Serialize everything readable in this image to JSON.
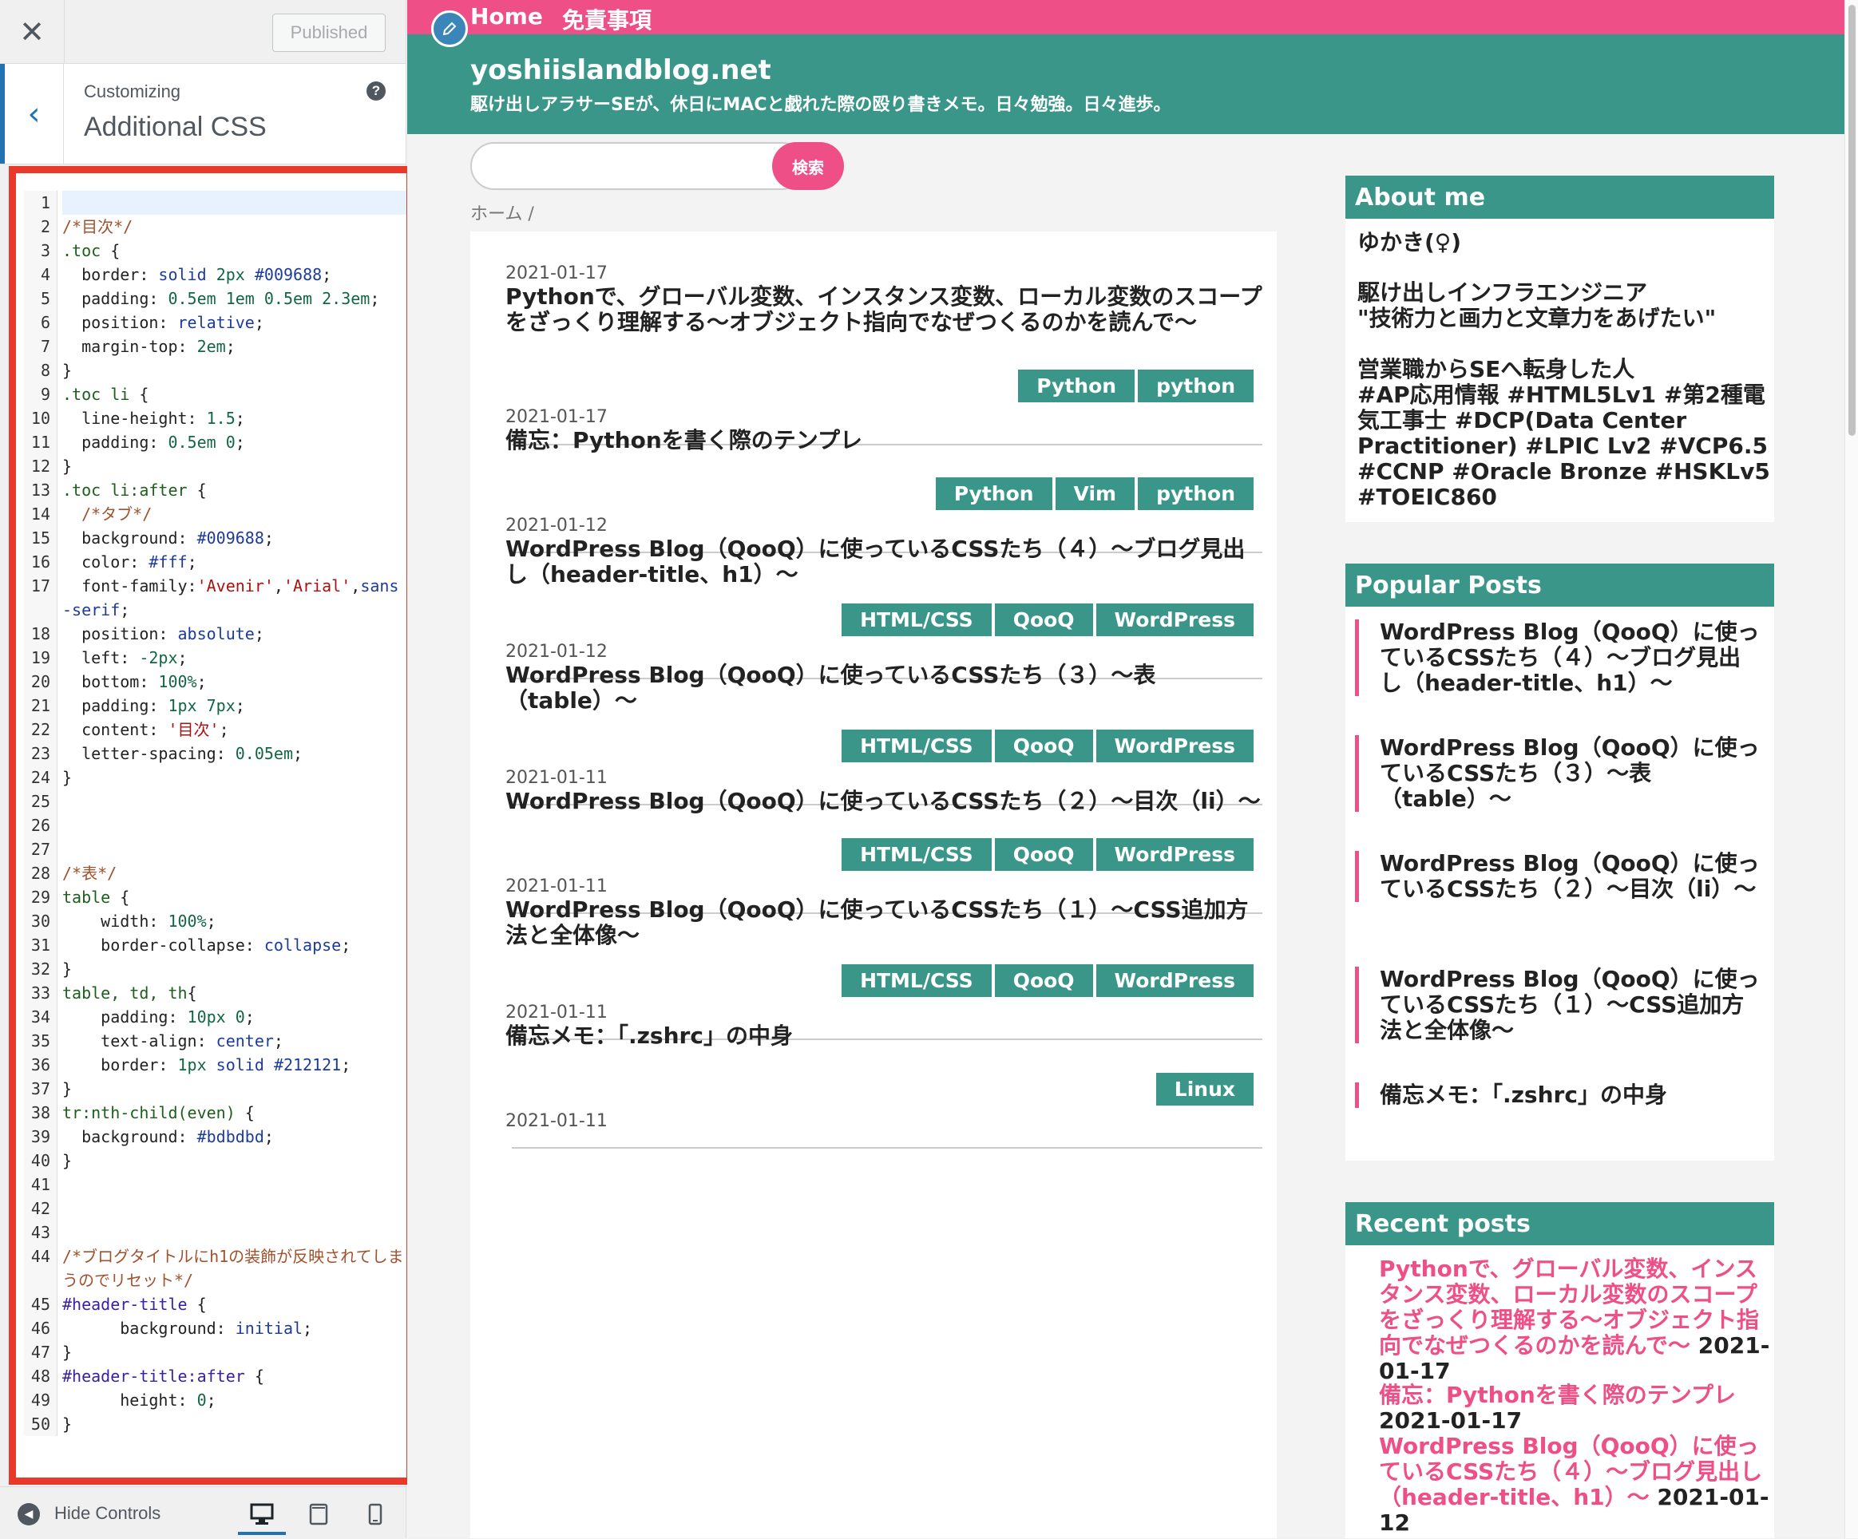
{
  "panel": {
    "close_icon": "✕",
    "published_label": "Published",
    "back_icon": "‹",
    "customizing_label": "Customizing",
    "section_title": "Additional CSS",
    "help_icon": "?",
    "hide_controls_label": "Hide Controls",
    "accent_color": "#2271b1",
    "highlight_color": "#e8392b"
  },
  "code_lines": [
    {
      "n": "1",
      "active": true,
      "parts": []
    },
    {
      "n": "2",
      "parts": [
        [
          "com",
          "/*目次*/"
        ]
      ]
    },
    {
      "n": "3",
      "parts": [
        [
          "sel",
          ".toc"
        ],
        [
          "",
          " {"
        ]
      ]
    },
    {
      "n": "4",
      "parts": [
        [
          "",
          "  border: "
        ],
        [
          "val",
          "solid"
        ],
        [
          "",
          " "
        ],
        [
          "num",
          "2px"
        ],
        [
          "",
          " "
        ],
        [
          "val",
          "#009688"
        ],
        [
          "",
          ";"
        ]
      ]
    },
    {
      "n": "5",
      "parts": [
        [
          "",
          "  padding: "
        ],
        [
          "num",
          "0.5em 1em 0.5em 2.3em"
        ],
        [
          "",
          ";"
        ]
      ]
    },
    {
      "n": "6",
      "parts": [
        [
          "",
          "  position: "
        ],
        [
          "val",
          "relative"
        ],
        [
          "",
          ";"
        ]
      ]
    },
    {
      "n": "7",
      "parts": [
        [
          "",
          "  margin-top: "
        ],
        [
          "num",
          "2em"
        ],
        [
          "",
          ";"
        ]
      ]
    },
    {
      "n": "8",
      "parts": [
        [
          "",
          "}"
        ]
      ]
    },
    {
      "n": "9",
      "parts": [
        [
          "sel",
          ".toc li"
        ],
        [
          "",
          " {"
        ]
      ]
    },
    {
      "n": "10",
      "parts": [
        [
          "",
          "  line-height: "
        ],
        [
          "num",
          "1.5"
        ],
        [
          "",
          ";"
        ]
      ]
    },
    {
      "n": "11",
      "parts": [
        [
          "",
          "  padding: "
        ],
        [
          "num",
          "0.5em 0"
        ],
        [
          "",
          ";"
        ]
      ]
    },
    {
      "n": "12",
      "parts": [
        [
          "",
          "}"
        ]
      ]
    },
    {
      "n": "13",
      "parts": [
        [
          "sel",
          ".toc li:after"
        ],
        [
          "",
          " {"
        ]
      ]
    },
    {
      "n": "14",
      "parts": [
        [
          "com",
          "  /*タブ*/"
        ]
      ]
    },
    {
      "n": "15",
      "parts": [
        [
          "",
          "  background: "
        ],
        [
          "val",
          "#009688"
        ],
        [
          "",
          ";"
        ]
      ]
    },
    {
      "n": "16",
      "parts": [
        [
          "",
          "  color: "
        ],
        [
          "val",
          "#fff"
        ],
        [
          "",
          ";"
        ]
      ]
    },
    {
      "n": "17",
      "parts": [
        [
          "",
          "  font-family:"
        ],
        [
          "str",
          "'Avenir'"
        ],
        [
          "",
          ","
        ],
        [
          "str",
          "'Arial'"
        ],
        [
          "",
          ","
        ],
        [
          "val",
          "sans-serif"
        ],
        [
          "",
          ";"
        ]
      ]
    },
    {
      "n": "18",
      "parts": [
        [
          "",
          "  position: "
        ],
        [
          "val",
          "absolute"
        ],
        [
          "",
          ";"
        ]
      ]
    },
    {
      "n": "19",
      "parts": [
        [
          "",
          "  left: "
        ],
        [
          "num",
          "-2px"
        ],
        [
          "",
          ";"
        ]
      ]
    },
    {
      "n": "20",
      "parts": [
        [
          "",
          "  bottom: "
        ],
        [
          "num",
          "100%"
        ],
        [
          "",
          ";"
        ]
      ]
    },
    {
      "n": "21",
      "parts": [
        [
          "",
          "  padding: "
        ],
        [
          "num",
          "1px 7px"
        ],
        [
          "",
          ";"
        ]
      ]
    },
    {
      "n": "22",
      "parts": [
        [
          "",
          "  content: "
        ],
        [
          "str",
          "'目次'"
        ],
        [
          "",
          ";"
        ]
      ]
    },
    {
      "n": "23",
      "parts": [
        [
          "",
          "  letter-spacing: "
        ],
        [
          "num",
          "0.05em"
        ],
        [
          "",
          ";"
        ]
      ]
    },
    {
      "n": "24",
      "parts": [
        [
          "",
          "}"
        ]
      ]
    },
    {
      "n": "25",
      "parts": []
    },
    {
      "n": "26",
      "parts": []
    },
    {
      "n": "27",
      "parts": []
    },
    {
      "n": "28",
      "parts": [
        [
          "com",
          "/*表*/"
        ]
      ]
    },
    {
      "n": "29",
      "parts": [
        [
          "sel",
          "table"
        ],
        [
          "",
          " {"
        ]
      ]
    },
    {
      "n": "30",
      "parts": [
        [
          "",
          "    width: "
        ],
        [
          "num",
          "100%"
        ],
        [
          "",
          ";"
        ]
      ]
    },
    {
      "n": "31",
      "parts": [
        [
          "",
          "    border-collapse: "
        ],
        [
          "val",
          "collapse"
        ],
        [
          "",
          ";"
        ]
      ]
    },
    {
      "n": "32",
      "parts": [
        [
          "",
          "}"
        ]
      ]
    },
    {
      "n": "33",
      "parts": [
        [
          "sel",
          "table, td, th"
        ],
        [
          "",
          "{"
        ]
      ]
    },
    {
      "n": "34",
      "parts": [
        [
          "",
          "    padding: "
        ],
        [
          "num",
          "10px 0"
        ],
        [
          "",
          ";"
        ]
      ]
    },
    {
      "n": "35",
      "parts": [
        [
          "",
          "    text-align: "
        ],
        [
          "val",
          "center"
        ],
        [
          "",
          ";"
        ]
      ]
    },
    {
      "n": "36",
      "parts": [
        [
          "",
          "    border: "
        ],
        [
          "num",
          "1px"
        ],
        [
          "",
          " "
        ],
        [
          "val",
          "solid"
        ],
        [
          "",
          " "
        ],
        [
          "val",
          "#212121"
        ],
        [
          "",
          ";"
        ]
      ]
    },
    {
      "n": "37",
      "parts": [
        [
          "",
          "}"
        ]
      ]
    },
    {
      "n": "38",
      "parts": [
        [
          "sel",
          "tr:nth-child(even)"
        ],
        [
          "",
          " {"
        ]
      ]
    },
    {
      "n": "39",
      "parts": [
        [
          "",
          "  background: "
        ],
        [
          "val",
          "#bdbdbd"
        ],
        [
          "",
          ";"
        ]
      ]
    },
    {
      "n": "40",
      "parts": [
        [
          "",
          "}"
        ]
      ]
    },
    {
      "n": "41",
      "parts": []
    },
    {
      "n": "42",
      "parts": []
    },
    {
      "n": "43",
      "parts": []
    },
    {
      "n": "44",
      "parts": [
        [
          "com",
          "/*ブログタイトルにh1の装飾が反映されてしまうのでリセット*/"
        ]
      ]
    },
    {
      "n": "45",
      "parts": [
        [
          "id",
          "#header-title"
        ],
        [
          "",
          " {"
        ]
      ]
    },
    {
      "n": "46",
      "parts": [
        [
          "",
          "      background: "
        ],
        [
          "val",
          "initial"
        ],
        [
          "",
          ";"
        ]
      ]
    },
    {
      "n": "47",
      "parts": [
        [
          "",
          "}"
        ]
      ]
    },
    {
      "n": "48",
      "parts": [
        [
          "id",
          "#header-title:after"
        ],
        [
          "",
          " {"
        ]
      ]
    },
    {
      "n": "49",
      "parts": [
        [
          "",
          "      height: "
        ],
        [
          "num",
          "0"
        ],
        [
          "",
          ";"
        ]
      ]
    },
    {
      "n": "50",
      "parts": [
        [
          "",
          "}"
        ]
      ]
    }
  ],
  "site": {
    "nav": [
      "Home",
      "免責事項"
    ],
    "title": "yoshiislandblog.net",
    "description": "駆け出しアラサーSEが、休日にMACと戯れた際の殴り書きメモ。日々勉強。日々進歩。",
    "search_button": "検索",
    "search_placeholder": "",
    "breadcrumb": "ホーム /",
    "pink": "#ee4f86",
    "teal": "#3a9688"
  },
  "posts": [
    {
      "date": "2021-01-17",
      "title": "Pythonで、グローバル変数、インスタンス変数、ローカル変数のスコープをざっくり理解する〜オブジェクト指向でなぜつくるのかを読んで〜",
      "tags": [
        "Python",
        "python"
      ]
    },
    {
      "date": "2021-01-17",
      "title": "備忘：Pythonを書く際のテンプレ",
      "tags": [
        "Python",
        "Vim",
        "python"
      ]
    },
    {
      "date": "2021-01-12",
      "title": "WordPress Blog（QooQ）に使っているCSSたち（４）〜ブログ見出し（header-title、h1）〜",
      "tags": [
        "HTML/CSS",
        "QooQ",
        "WordPress"
      ]
    },
    {
      "date": "2021-01-12",
      "title": "WordPress Blog（QooQ）に使っているCSSたち（３）〜表（table）〜",
      "tags": [
        "HTML/CSS",
        "QooQ",
        "WordPress"
      ]
    },
    {
      "date": "2021-01-11",
      "title": "WordPress Blog（QooQ）に使っているCSSたち（２）〜目次（li）〜",
      "tags": [
        "HTML/CSS",
        "QooQ",
        "WordPress"
      ]
    },
    {
      "date": "2021-01-11",
      "title": "WordPress Blog（QooQ）に使っているCSSたち（１）〜CSS追加方法と全体像〜",
      "tags": [
        "HTML/CSS",
        "QooQ",
        "WordPress"
      ]
    },
    {
      "date": "2021-01-11",
      "title": "備忘メモ：「.zshrc」の中身",
      "tags": [
        "Linux"
      ]
    },
    {
      "date": "2021-01-11",
      "title": "",
      "tags": []
    }
  ],
  "sidebar": {
    "about": {
      "title": "About me",
      "lines": [
        "ゆかき(♀)",
        "",
        "駆け出しインフラエンジニア",
        "\"技術力と画力と文章力をあげたい\"",
        "",
        "営業職からSEへ転身した人",
        "#AP応用情報 #HTML5Lv1 #第2種電",
        "気工事士 #DCP(Data Center",
        "Practitioner) #LPIC Lv2 #VCP6.5",
        "#CCNP #Oracle Bronze #HSKLv5",
        "#TOEIC860"
      ]
    },
    "popular": {
      "title": "Popular Posts",
      "items": [
        "WordPress Blog（QooQ）に使っているCSSたち（４）〜ブログ見出し（header-title、h1）〜",
        "WordPress Blog（QooQ）に使っているCSSたち（３）〜表（table）〜",
        "WordPress Blog（QooQ）に使っているCSSたち（２）〜目次（li）〜",
        "WordPress Blog（QooQ）に使っているCSSたち（１）〜CSS追加方法と全体像〜",
        "備忘メモ：「.zshrc」の中身"
      ]
    },
    "recent": {
      "title": "Recent posts",
      "items": [
        {
          "title": "Pythonで、グローバル変数、インスタンス変数、ローカル変数のスコープをざっくり理解する〜オブジェクト指向でなぜつくるのかを読んで〜",
          "date": "2021-01-17"
        },
        {
          "title": "備忘：Pythonを書く際のテンプレ",
          "date": "2021-01-17"
        },
        {
          "title": "WordPress Blog（QooQ）に使っているCSSたち（４）〜ブログ見出し（header-title、h1）〜",
          "date": "2021-01-12"
        }
      ]
    }
  }
}
